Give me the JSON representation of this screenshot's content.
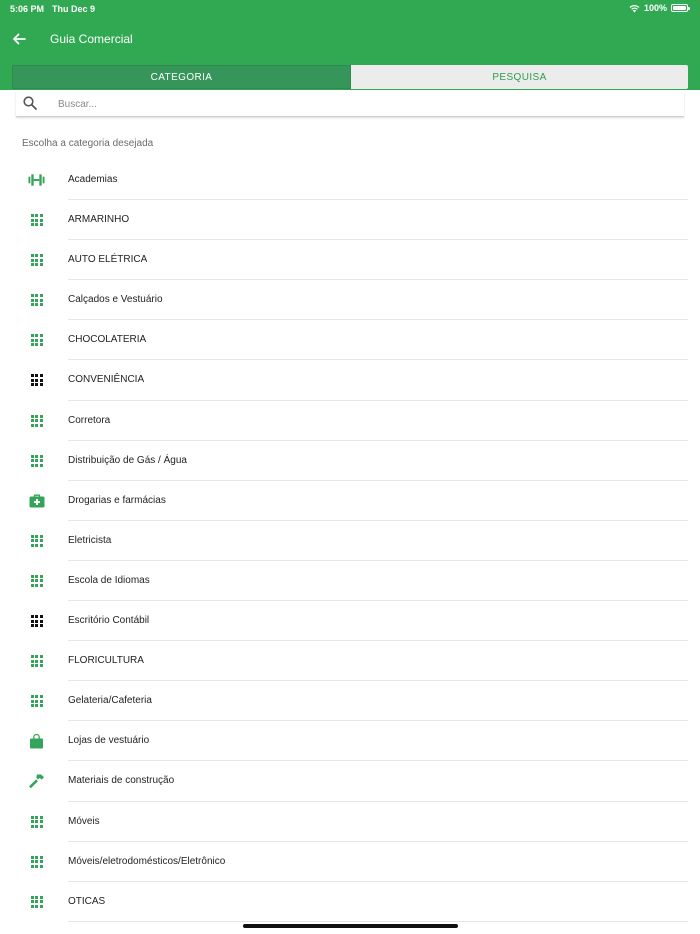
{
  "status_bar": {
    "time": "5:06 PM",
    "date": "Thu Dec 9",
    "battery": "100%"
  },
  "header": {
    "title": "Guia Comercial"
  },
  "tabs": [
    {
      "label": "CATEGORIA",
      "active": true
    },
    {
      "label": "PESQUISA",
      "active": false
    }
  ],
  "search": {
    "placeholder": "Buscar...",
    "value": ""
  },
  "section_title": "Escolha a categoria desejada",
  "colors": {
    "brand": "#31a952",
    "tab_active": "#36955a",
    "icon_green": "#34a45a"
  },
  "categories": [
    {
      "label": "Academias",
      "icon": "dumbbell-icon"
    },
    {
      "label": "ARMARINHO",
      "icon": "grid-icon"
    },
    {
      "label": "AUTO ELÉTRICA",
      "icon": "grid-icon"
    },
    {
      "label": "Calçados e Vestuário",
      "icon": "grid-icon"
    },
    {
      "label": "CHOCOLATERIA",
      "icon": "grid-icon"
    },
    {
      "label": "CONVENIÊNCIA",
      "icon": "grid-dark-icon"
    },
    {
      "label": "Corretora",
      "icon": "grid-icon"
    },
    {
      "label": "Distribuição de Gás / Água",
      "icon": "grid-icon"
    },
    {
      "label": "Drogarias e farmácias",
      "icon": "medical-kit-icon"
    },
    {
      "label": "Eletricista",
      "icon": "grid-icon"
    },
    {
      "label": "Escola de Idiomas",
      "icon": "grid-icon"
    },
    {
      "label": "Escritório Contábil",
      "icon": "grid-dark-icon"
    },
    {
      "label": "FLORICULTURA",
      "icon": "grid-icon"
    },
    {
      "label": "Gelateria/Cafeteria",
      "icon": "grid-icon"
    },
    {
      "label": "Lojas de vestuário",
      "icon": "shopping-bag-icon"
    },
    {
      "label": "Materiais de construção",
      "icon": "hammer-icon"
    },
    {
      "label": "Móveis",
      "icon": "grid-icon"
    },
    {
      "label": "Móveis/eletrodomésticos/Eletrônico",
      "icon": "grid-icon"
    },
    {
      "label": "OTICAS",
      "icon": "grid-icon"
    }
  ]
}
